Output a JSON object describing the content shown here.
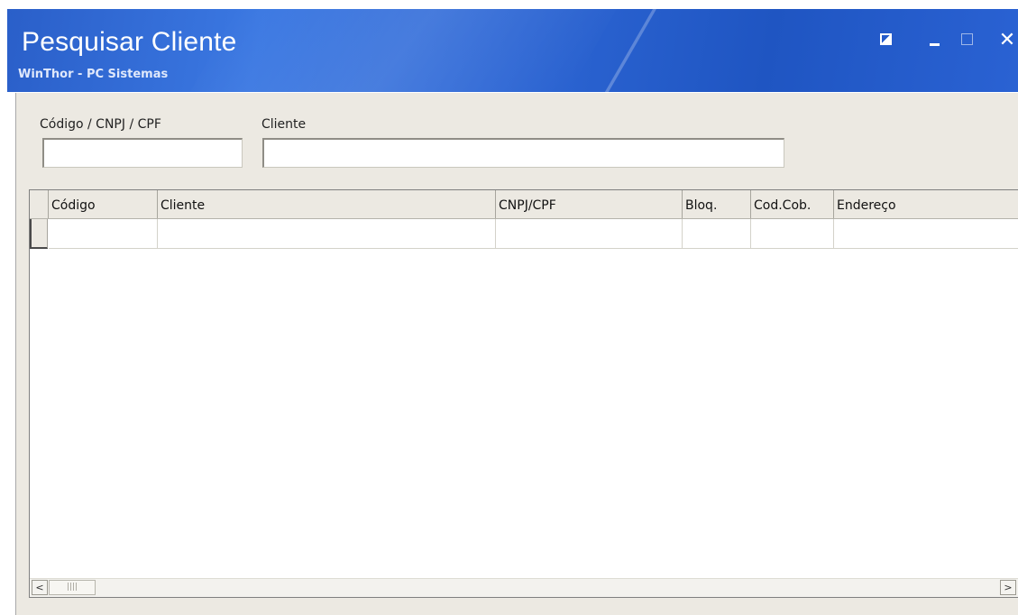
{
  "window": {
    "title": "Pesquisar Cliente",
    "subtitle": "WinThor - PC Sistemas",
    "controls": {
      "restore_icon": "restore-icon",
      "minimize_glyph": "_",
      "maximize_icon": "maximize-icon",
      "close_glyph": "✕"
    }
  },
  "filters": {
    "codigo_label": "Código / CNPJ / CPF",
    "codigo_value": "",
    "cliente_label": "Cliente",
    "cliente_value": ""
  },
  "grid": {
    "columns": [
      "Código",
      "Cliente",
      "CNPJ/CPF",
      "Bloq.",
      "Cod.Cob.",
      "Endereço"
    ],
    "rows": [
      [
        "",
        "",
        "",
        "",
        "",
        ""
      ]
    ]
  },
  "scrollbar": {
    "left_glyph": "<",
    "right_glyph": ">",
    "thumb_grip": "||||"
  },
  "colors": {
    "titlebar": "#2d66d4",
    "client_bg": "#ece9e2"
  }
}
